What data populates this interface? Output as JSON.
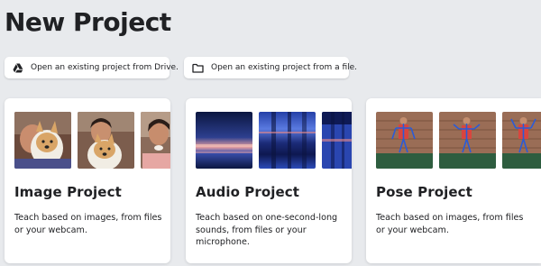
{
  "page": {
    "title": "New Project"
  },
  "open_options": {
    "drive": {
      "label": "Open an existing project from Drive.",
      "icon": "google-drive-icon"
    },
    "file": {
      "label": "Open an existing project from a file.",
      "icon": "folder-icon"
    }
  },
  "cards": {
    "image": {
      "title": "Image Project",
      "description": "Teach based on images, from files or your webcam."
    },
    "audio": {
      "title": "Audio Project",
      "description": "Teach based on one-second-long sounds, from files or your microphone."
    },
    "pose": {
      "title": "Pose Project",
      "description": "Teach based on images, from files or your webcam."
    }
  },
  "colors": {
    "background": "#e8eaed",
    "card": "#ffffff",
    "text": "#202124",
    "spectrogram_dark": "#0d1b4a",
    "spectrogram_accent": "#e98b8b",
    "pose_skeleton": "#2a5bd7"
  }
}
